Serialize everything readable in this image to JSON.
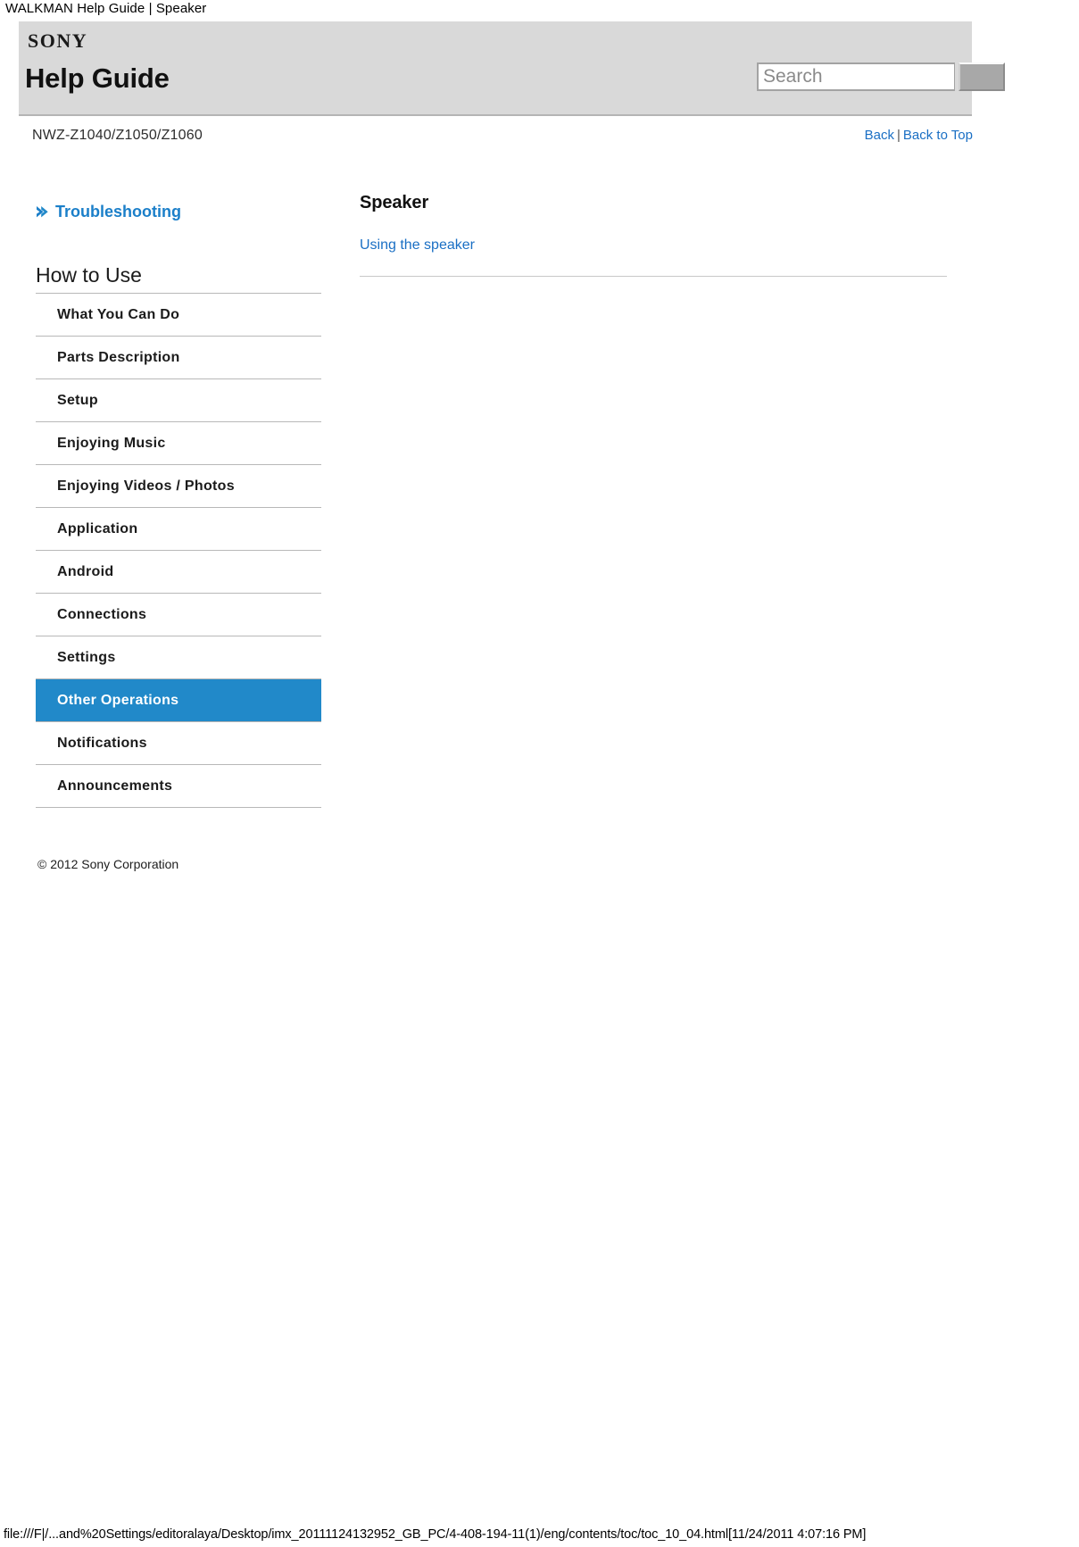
{
  "print_header": {
    "title": "WALKMAN Help Guide | Speaker"
  },
  "header": {
    "brand": "SONY",
    "title": "Help Guide",
    "model": "NWZ-Z1040/Z1050/Z1060",
    "brand_icon": "sony-logo",
    "search": {
      "placeholder": "Search",
      "value": "",
      "button_label": "",
      "button_icon": "search-submit-icon"
    },
    "topnav": {
      "back": "Back",
      "separator": "|",
      "back_to_top": "Back to Top"
    }
  },
  "sidebar": {
    "troubleshooting": {
      "label": "Troubleshooting",
      "icon": "chevron-right-icon"
    },
    "section_heading": "How to Use",
    "items": [
      {
        "label": "What You Can Do",
        "selected": false
      },
      {
        "label": "Parts Description",
        "selected": false
      },
      {
        "label": "Setup",
        "selected": false
      },
      {
        "label": "Enjoying Music",
        "selected": false
      },
      {
        "label": "Enjoying Videos / Photos",
        "selected": false
      },
      {
        "label": "Application",
        "selected": false
      },
      {
        "label": "Android",
        "selected": false
      },
      {
        "label": "Connections",
        "selected": false
      },
      {
        "label": "Settings",
        "selected": false
      },
      {
        "label": "Other Operations",
        "selected": true
      },
      {
        "label": "Notifications",
        "selected": false
      },
      {
        "label": "Announcements",
        "selected": false
      }
    ],
    "copyright": "© 2012 Sony Corporation"
  },
  "main": {
    "title": "Speaker",
    "links": [
      {
        "label": "Using the speaker"
      }
    ]
  },
  "footer": {
    "url": "file:///F|/...and%20Settings/editoralaya/Desktop/imx_20111124132952_GB_PC/4-408-194-11(1)/eng/contents/toc/toc_10_04.html[11/24/2011 4:07:16 PM]"
  },
  "colors": {
    "accent_blue": "#2189c9",
    "link_blue": "#1a6fc4",
    "header_band": "#d9d9d9",
    "rule": "#b8b8b8"
  }
}
